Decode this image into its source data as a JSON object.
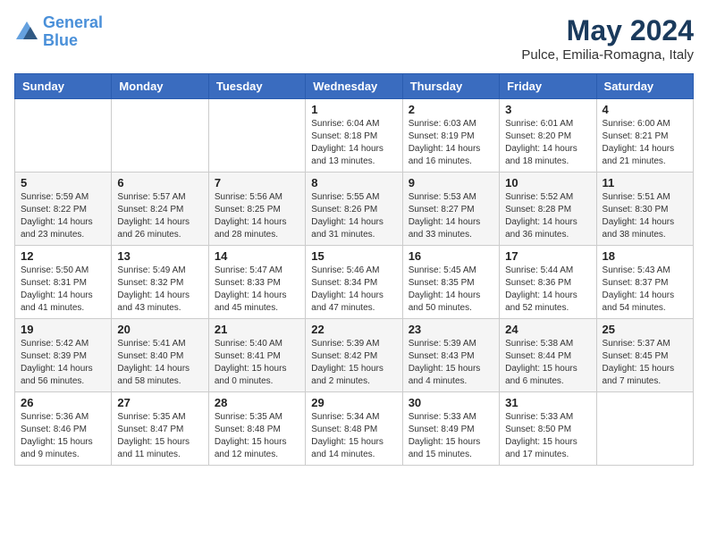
{
  "header": {
    "logo_line1": "General",
    "logo_line2": "Blue",
    "month_year": "May 2024",
    "location": "Pulce, Emilia-Romagna, Italy"
  },
  "days_of_week": [
    "Sunday",
    "Monday",
    "Tuesday",
    "Wednesday",
    "Thursday",
    "Friday",
    "Saturday"
  ],
  "weeks": [
    [
      {
        "day": "",
        "info": ""
      },
      {
        "day": "",
        "info": ""
      },
      {
        "day": "",
        "info": ""
      },
      {
        "day": "1",
        "info": "Sunrise: 6:04 AM\nSunset: 8:18 PM\nDaylight: 14 hours and 13 minutes."
      },
      {
        "day": "2",
        "info": "Sunrise: 6:03 AM\nSunset: 8:19 PM\nDaylight: 14 hours and 16 minutes."
      },
      {
        "day": "3",
        "info": "Sunrise: 6:01 AM\nSunset: 8:20 PM\nDaylight: 14 hours and 18 minutes."
      },
      {
        "day": "4",
        "info": "Sunrise: 6:00 AM\nSunset: 8:21 PM\nDaylight: 14 hours and 21 minutes."
      }
    ],
    [
      {
        "day": "5",
        "info": "Sunrise: 5:59 AM\nSunset: 8:22 PM\nDaylight: 14 hours and 23 minutes."
      },
      {
        "day": "6",
        "info": "Sunrise: 5:57 AM\nSunset: 8:24 PM\nDaylight: 14 hours and 26 minutes."
      },
      {
        "day": "7",
        "info": "Sunrise: 5:56 AM\nSunset: 8:25 PM\nDaylight: 14 hours and 28 minutes."
      },
      {
        "day": "8",
        "info": "Sunrise: 5:55 AM\nSunset: 8:26 PM\nDaylight: 14 hours and 31 minutes."
      },
      {
        "day": "9",
        "info": "Sunrise: 5:53 AM\nSunset: 8:27 PM\nDaylight: 14 hours and 33 minutes."
      },
      {
        "day": "10",
        "info": "Sunrise: 5:52 AM\nSunset: 8:28 PM\nDaylight: 14 hours and 36 minutes."
      },
      {
        "day": "11",
        "info": "Sunrise: 5:51 AM\nSunset: 8:30 PM\nDaylight: 14 hours and 38 minutes."
      }
    ],
    [
      {
        "day": "12",
        "info": "Sunrise: 5:50 AM\nSunset: 8:31 PM\nDaylight: 14 hours and 41 minutes."
      },
      {
        "day": "13",
        "info": "Sunrise: 5:49 AM\nSunset: 8:32 PM\nDaylight: 14 hours and 43 minutes."
      },
      {
        "day": "14",
        "info": "Sunrise: 5:47 AM\nSunset: 8:33 PM\nDaylight: 14 hours and 45 minutes."
      },
      {
        "day": "15",
        "info": "Sunrise: 5:46 AM\nSunset: 8:34 PM\nDaylight: 14 hours and 47 minutes."
      },
      {
        "day": "16",
        "info": "Sunrise: 5:45 AM\nSunset: 8:35 PM\nDaylight: 14 hours and 50 minutes."
      },
      {
        "day": "17",
        "info": "Sunrise: 5:44 AM\nSunset: 8:36 PM\nDaylight: 14 hours and 52 minutes."
      },
      {
        "day": "18",
        "info": "Sunrise: 5:43 AM\nSunset: 8:37 PM\nDaylight: 14 hours and 54 minutes."
      }
    ],
    [
      {
        "day": "19",
        "info": "Sunrise: 5:42 AM\nSunset: 8:39 PM\nDaylight: 14 hours and 56 minutes."
      },
      {
        "day": "20",
        "info": "Sunrise: 5:41 AM\nSunset: 8:40 PM\nDaylight: 14 hours and 58 minutes."
      },
      {
        "day": "21",
        "info": "Sunrise: 5:40 AM\nSunset: 8:41 PM\nDaylight: 15 hours and 0 minutes."
      },
      {
        "day": "22",
        "info": "Sunrise: 5:39 AM\nSunset: 8:42 PM\nDaylight: 15 hours and 2 minutes."
      },
      {
        "day": "23",
        "info": "Sunrise: 5:39 AM\nSunset: 8:43 PM\nDaylight: 15 hours and 4 minutes."
      },
      {
        "day": "24",
        "info": "Sunrise: 5:38 AM\nSunset: 8:44 PM\nDaylight: 15 hours and 6 minutes."
      },
      {
        "day": "25",
        "info": "Sunrise: 5:37 AM\nSunset: 8:45 PM\nDaylight: 15 hours and 7 minutes."
      }
    ],
    [
      {
        "day": "26",
        "info": "Sunrise: 5:36 AM\nSunset: 8:46 PM\nDaylight: 15 hours and 9 minutes."
      },
      {
        "day": "27",
        "info": "Sunrise: 5:35 AM\nSunset: 8:47 PM\nDaylight: 15 hours and 11 minutes."
      },
      {
        "day": "28",
        "info": "Sunrise: 5:35 AM\nSunset: 8:48 PM\nDaylight: 15 hours and 12 minutes."
      },
      {
        "day": "29",
        "info": "Sunrise: 5:34 AM\nSunset: 8:48 PM\nDaylight: 15 hours and 14 minutes."
      },
      {
        "day": "30",
        "info": "Sunrise: 5:33 AM\nSunset: 8:49 PM\nDaylight: 15 hours and 15 minutes."
      },
      {
        "day": "31",
        "info": "Sunrise: 5:33 AM\nSunset: 8:50 PM\nDaylight: 15 hours and 17 minutes."
      },
      {
        "day": "",
        "info": ""
      }
    ]
  ]
}
